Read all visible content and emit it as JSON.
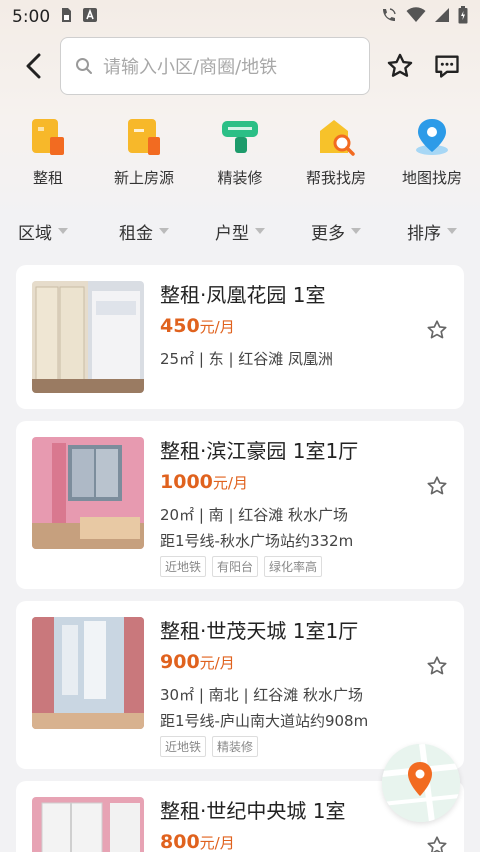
{
  "status": {
    "time": "5:00",
    "icons": [
      "sim-card-icon",
      "text-a-icon",
      "call-wifi-icon",
      "wifi-icon",
      "signal-icon",
      "battery-icon"
    ]
  },
  "header": {
    "search_placeholder": "请输入小区/商圈/地铁",
    "icons": [
      "back-arrow-icon",
      "star-icon",
      "message-icon"
    ]
  },
  "categories": [
    {
      "label": "整租",
      "icon": "building-icon",
      "color": "#f5a623"
    },
    {
      "label": "新上房源",
      "icon": "new-listing-icon",
      "color": "#f5a623"
    },
    {
      "label": "精装修",
      "icon": "paint-roller-icon",
      "color": "#2bbf86"
    },
    {
      "label": "帮我找房",
      "icon": "house-search-icon",
      "color": "#f5b623"
    },
    {
      "label": "地图找房",
      "icon": "map-pin-icon",
      "color": "#2c9be8"
    }
  ],
  "filters": [
    "区域",
    "租金",
    "户型",
    "更多",
    "排序"
  ],
  "listings": [
    {
      "title": "整租·凤凰花园 1室",
      "price": "450",
      "unit": "元/月",
      "info": "25㎡ | 东 | 红谷滩 凤凰洲",
      "distance": "",
      "tags": []
    },
    {
      "title": "整租·滨江豪园 1室1厅",
      "price": "1000",
      "unit": "元/月",
      "info": "20㎡ | 南 | 红谷滩 秋水广场",
      "distance": "距1号线-秋水广场站约332m",
      "tags": [
        "近地铁",
        "有阳台",
        "绿化率高"
      ]
    },
    {
      "title": "整租·世茂天城 1室1厅",
      "price": "900",
      "unit": "元/月",
      "info": "30㎡ | 南北 | 红谷滩 秋水广场",
      "distance": "距1号线-庐山南大道站约908m",
      "tags": [
        "近地铁",
        "精装修"
      ]
    },
    {
      "title": "整租·世纪中央城 1室",
      "price": "800",
      "unit": "元/月",
      "info": "",
      "distance": "",
      "tags": []
    }
  ],
  "colors": {
    "price": "#e0621e",
    "accent_orange": "#f26b21"
  }
}
